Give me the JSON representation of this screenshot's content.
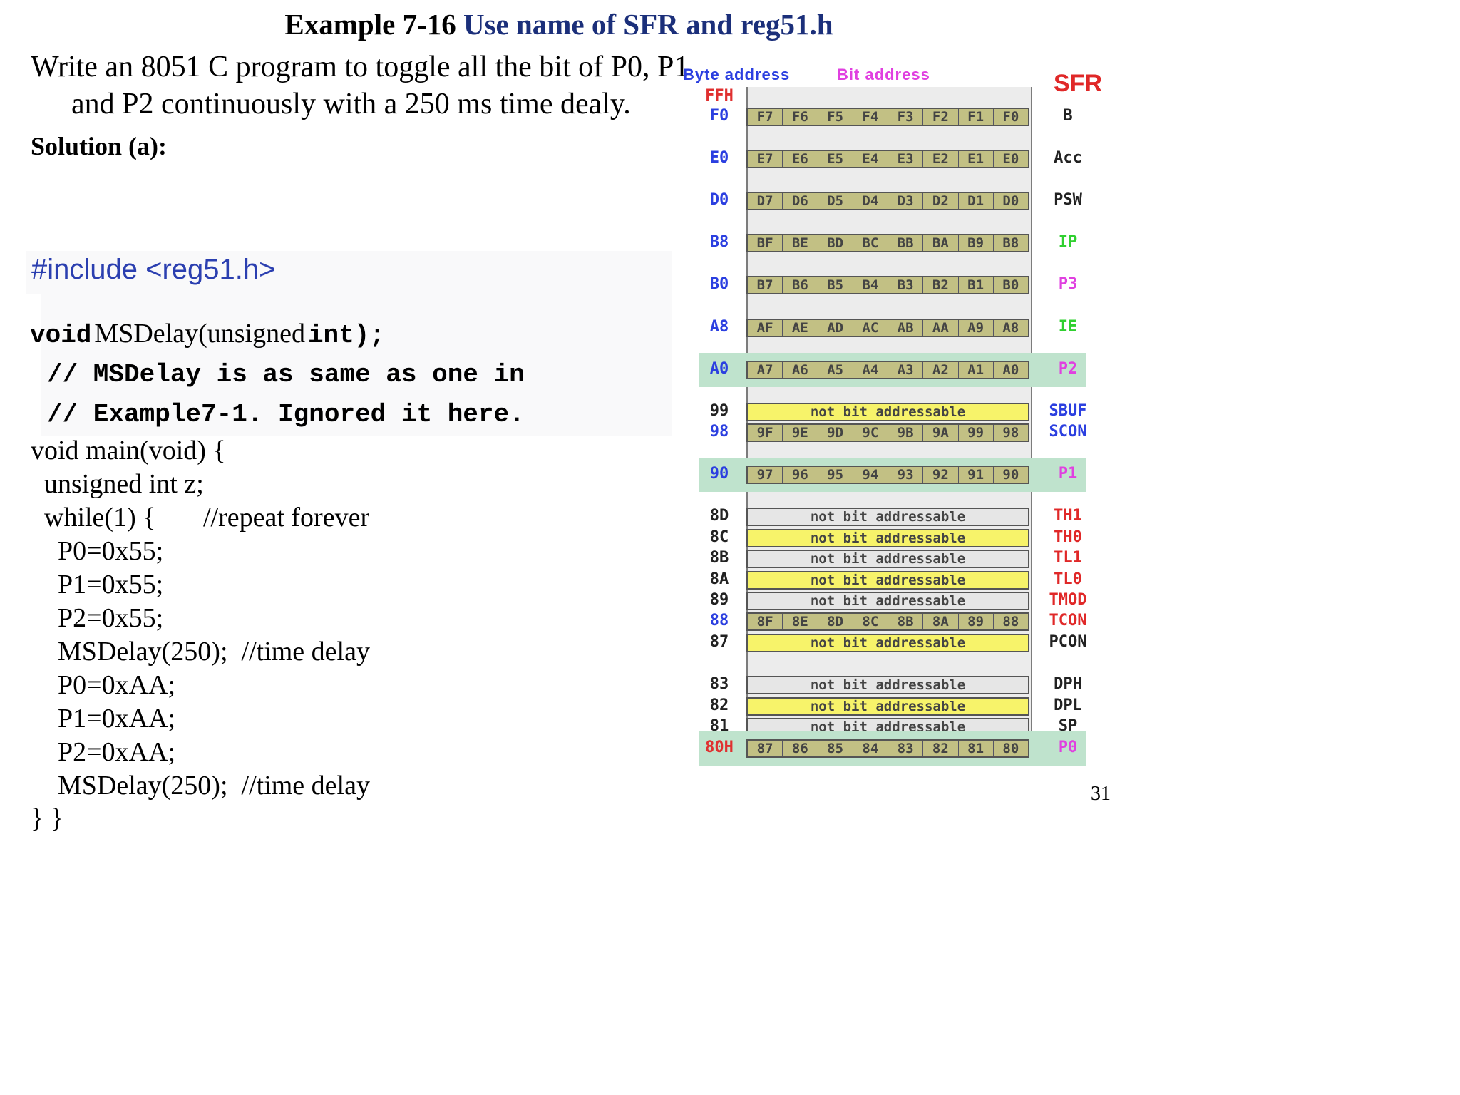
{
  "title": {
    "prefix": "Example 7-16",
    "accent": "Use name of SFR and reg51.h"
  },
  "problem": {
    "line1": "Write an 8051 C program to toggle all the bit of P0, P1",
    "line2": "and P2 continuously with a 250 ms time dealy."
  },
  "solution_label": "Solution (a):",
  "code": {
    "include": "#include <reg51.h>",
    "proto_kw": "void",
    "proto_mid": "MSDelay(unsigned",
    "proto_kw2": "int);",
    "comment1": "// MSDelay is as same as one in",
    "comment2": "// Example7-1. Ignored it here.",
    "lines": [
      "void main(void) {",
      "unsigned int z;",
      "while(1) {       //repeat forever",
      "P0=0x55;",
      "P1=0x55;",
      "P2=0x55;",
      "MSDelay(250);  //time delay",
      "P0=0xAA;",
      "P1=0xAA;",
      "P2=0xAA;",
      "MSDelay(250);  //time delay",
      "} }"
    ]
  },
  "sfr_table": {
    "header_byte": "Byte address",
    "header_bit": "Bit address",
    "header_sfr": "SFR",
    "top_address": "FFH",
    "na_text": "not bit addressable",
    "rows": [
      {
        "addr": "F0",
        "bits": [
          "F7",
          "F6",
          "F5",
          "F4",
          "F3",
          "F2",
          "F1",
          "F0"
        ],
        "sfr": "B"
      },
      {
        "addr": "E0",
        "bits": [
          "E7",
          "E6",
          "E5",
          "E4",
          "E3",
          "E2",
          "E1",
          "E0"
        ],
        "sfr": "Acc"
      },
      {
        "addr": "D0",
        "bits": [
          "D7",
          "D6",
          "D5",
          "D4",
          "D3",
          "D2",
          "D1",
          "D0"
        ],
        "sfr": "PSW"
      },
      {
        "addr": "B8",
        "bits": [
          "BF",
          "BE",
          "BD",
          "BC",
          "BB",
          "BA",
          "B9",
          "B8"
        ],
        "sfr": "IP"
      },
      {
        "addr": "B0",
        "bits": [
          "B7",
          "B6",
          "B5",
          "B4",
          "B3",
          "B2",
          "B1",
          "B0"
        ],
        "sfr": "P3"
      },
      {
        "addr": "A8",
        "bits": [
          "AF",
          "AE",
          "AD",
          "AC",
          "AB",
          "AA",
          "A9",
          "A8"
        ],
        "sfr": "IE"
      },
      {
        "addr": "A0",
        "bits": [
          "A7",
          "A6",
          "A5",
          "A4",
          "A3",
          "A2",
          "A1",
          "A0"
        ],
        "sfr": "P2"
      },
      {
        "addr": "99",
        "sfr": "SBUF"
      },
      {
        "addr": "98",
        "bits": [
          "9F",
          "9E",
          "9D",
          "9C",
          "9B",
          "9A",
          "99",
          "98"
        ],
        "sfr": "SCON"
      },
      {
        "addr": "90",
        "bits": [
          "97",
          "96",
          "95",
          "94",
          "93",
          "92",
          "91",
          "90"
        ],
        "sfr": "P1"
      },
      {
        "addr": "8D",
        "sfr": "TH1"
      },
      {
        "addr": "8C",
        "sfr": "TH0"
      },
      {
        "addr": "8B",
        "sfr": "TL1"
      },
      {
        "addr": "8A",
        "sfr": "TL0"
      },
      {
        "addr": "89",
        "sfr": "TMOD"
      },
      {
        "addr": "88",
        "bits": [
          "8F",
          "8E",
          "8D",
          "8C",
          "8B",
          "8A",
          "89",
          "88"
        ],
        "sfr": "TCON"
      },
      {
        "addr": "87",
        "sfr": "PCON"
      },
      {
        "addr": "83",
        "sfr": "DPH"
      },
      {
        "addr": "82",
        "sfr": "DPL"
      },
      {
        "addr": "81",
        "sfr": "SP"
      },
      {
        "addr": "80H",
        "bits": [
          "87",
          "86",
          "85",
          "84",
          "83",
          "82",
          "81",
          "80"
        ],
        "sfr": "P0"
      }
    ]
  },
  "colors": {
    "title_accent": "#1b2f7a",
    "include": "#2b3fb0",
    "addr_blue": "#2b3fe0",
    "addr_black": "#222222",
    "addr_red": "#e03030",
    "sfr_red": "#e02828",
    "sfr_magenta": "#e040e0",
    "sfr_green": "#30d030",
    "sfr_blue": "#2b3fe0",
    "sfr_black": "#222222"
  },
  "page_number": "31"
}
